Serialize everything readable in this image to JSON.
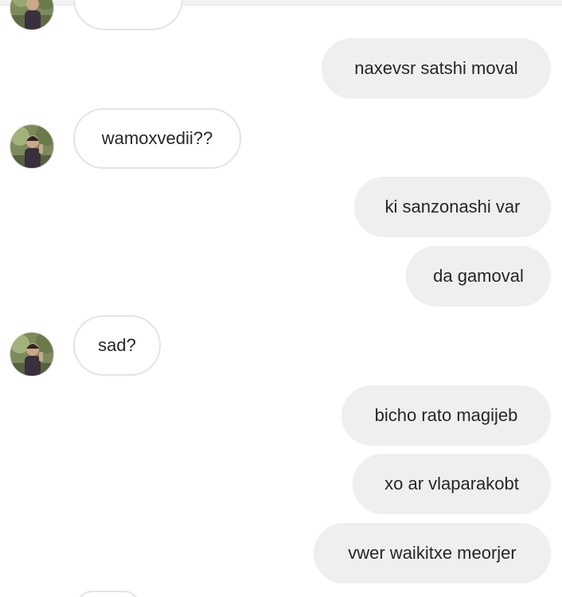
{
  "conversation": {
    "messages": [
      {
        "id": "m1",
        "from": "me",
        "text": "naxevsr satshi moval"
      },
      {
        "id": "m2",
        "from": "them",
        "text": "wamoxvedii??"
      },
      {
        "id": "m3",
        "from": "me",
        "text": "ki sanzonashi var"
      },
      {
        "id": "m4",
        "from": "me",
        "text": "da gamoval"
      },
      {
        "id": "m5",
        "from": "them",
        "text": "sad?"
      },
      {
        "id": "m6",
        "from": "me",
        "text": "bicho rato magijeb"
      },
      {
        "id": "m7",
        "from": "me",
        "text": "xo ar vlaparakobt"
      },
      {
        "id": "m8",
        "from": "me",
        "text": "vwer waikitxe meorjer"
      }
    ]
  },
  "icons": {
    "avatar": "contact-avatar-photo"
  },
  "colors": {
    "outgoing_bubble": "#efefef",
    "incoming_bubble_border": "#e4e4e4",
    "text": "#262626",
    "background": "#ffffff"
  }
}
